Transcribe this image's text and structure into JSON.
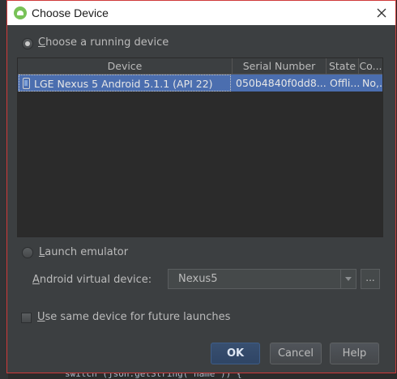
{
  "background": {
    "code_line": "switch (json.getString( name )) {"
  },
  "dialog": {
    "title": "Choose Device",
    "running_device": {
      "label_mnemonic": "C",
      "label_rest": "hoose a running device",
      "selected": true
    },
    "table": {
      "columns": [
        "Device",
        "Serial Number",
        "State",
        "Co..."
      ],
      "rows": [
        {
          "device": "LGE Nexus 5 Android 5.1.1 (API 22)",
          "serial": "050b4840f0dd8...",
          "state": "Offli...",
          "compatible": "No,...",
          "icon": "phone-icon",
          "selected": true
        }
      ]
    },
    "launch_emulator": {
      "label_mnemonic": "L",
      "label_rest": "aunch emulator",
      "selected": false
    },
    "avd": {
      "label_mnemonic": "A",
      "label_rest": "ndroid virtual device:",
      "selected_value": "Nexus5",
      "browse_label": "..."
    },
    "same_device": {
      "label_mnemonic": "U",
      "label_rest": "se same device for future launches",
      "checked": false
    },
    "buttons": {
      "ok": "OK",
      "cancel": "Cancel",
      "help": "Help"
    },
    "colors": {
      "selection": "#4b6eaf",
      "panel": "#3c3f41",
      "accent_border": "#cf3a3a"
    }
  }
}
